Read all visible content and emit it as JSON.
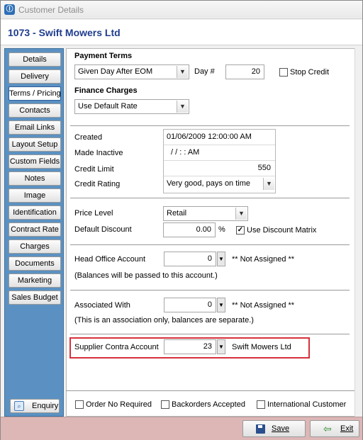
{
  "window": {
    "title": "Customer Details",
    "app_icon_glyph": "Ⓘ"
  },
  "header": {
    "title": "1073 - Swift Mowers Ltd"
  },
  "sidebar": {
    "items": [
      {
        "label": "Details"
      },
      {
        "label": "Delivery"
      },
      {
        "label": "Terms / Pricing"
      },
      {
        "label": "Contacts"
      },
      {
        "label": "Email Links"
      },
      {
        "label": "Layout Setup"
      },
      {
        "label": "Custom Fields"
      },
      {
        "label": "Notes"
      },
      {
        "label": "Image"
      },
      {
        "label": "Identification"
      },
      {
        "label": "Contract Rate"
      },
      {
        "label": "Charges"
      },
      {
        "label": "Documents"
      },
      {
        "label": "Marketing"
      },
      {
        "label": "Sales Budget"
      }
    ],
    "active": "Terms / Pricing",
    "enquiry_label": "Enquiry"
  },
  "payment_terms": {
    "heading": "Payment Terms",
    "value": "Given Day After EOM",
    "day_label": "Day #",
    "day_value": "20",
    "stop_credit_label": "Stop Credit",
    "stop_credit_checked": false
  },
  "finance_charges": {
    "heading": "Finance Charges",
    "value": "Use Default Rate"
  },
  "account_info": {
    "created_label": "Created",
    "created_value": "01/06/2009 12:00:00 AM",
    "made_inactive_label": "Made Inactive",
    "made_inactive_value": "/ /      : :  AM",
    "credit_limit_label": "Credit Limit",
    "credit_limit_value": "550",
    "credit_rating_label": "Credit Rating",
    "credit_rating_value": "Very good, pays on time"
  },
  "pricing": {
    "price_level_label": "Price Level",
    "price_level_value": "Retail",
    "default_discount_label": "Default Discount",
    "default_discount_value": "0.00",
    "percent_symbol": "%",
    "use_discount_matrix_label": "Use Discount Matrix",
    "use_discount_matrix_checked": true
  },
  "head_office": {
    "label": "Head Office Account",
    "value": "0",
    "assigned_text": "** Not Assigned **",
    "note": "(Balances will be passed to this account.)"
  },
  "associated": {
    "label": "Associated With",
    "value": "0",
    "assigned_text": "** Not Assigned **",
    "note": "(This is an association only, balances are separate.)"
  },
  "supplier_contra": {
    "label": "Supplier Contra Account",
    "value": "23",
    "name": "Swift Mowers Ltd"
  },
  "options": {
    "order_no_required": {
      "label": "Order No Required",
      "checked": false
    },
    "backorders_accepted": {
      "label": "Backorders Accepted",
      "checked": false
    },
    "international_customer": {
      "label": "International Customer",
      "checked": false
    }
  },
  "footer": {
    "save_label": "Save",
    "exit_label": "Exit"
  },
  "colors": {
    "sidebar_bg": "#5b91c2",
    "header_text": "#1f3d8f",
    "highlight_border": "#d6313a",
    "bottom_bar": "#ddb6b6"
  }
}
